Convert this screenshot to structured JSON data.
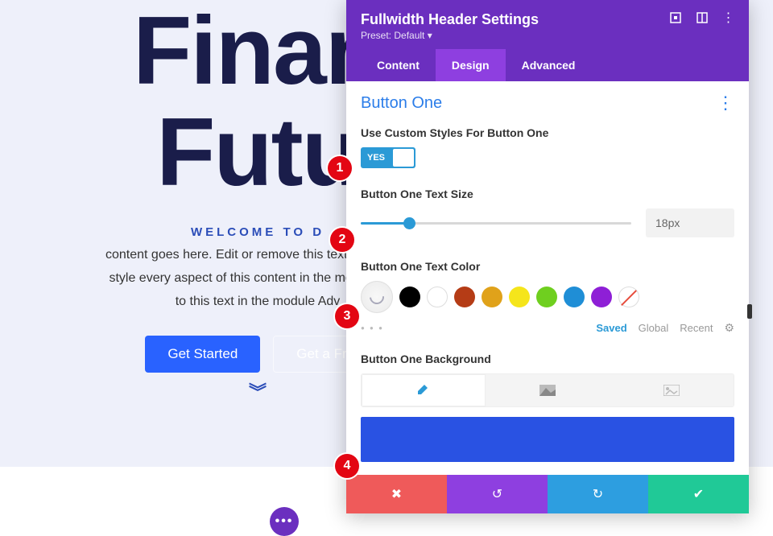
{
  "hero": {
    "title_line1": "Finan",
    "title_line2": "Futu",
    "subtitle": "Welcome to D",
    "body": "content goes here. Edit or remove this text inline or in\nstyle every aspect of this content in the module Desi\nto this text in the module Adv",
    "btn_primary": "Get Started",
    "btn_ghost": "Get a Fr"
  },
  "panel": {
    "title": "Fullwidth Header Settings",
    "preset": "Preset: Default ▾",
    "tabs": [
      "Content",
      "Design",
      "Advanced"
    ],
    "active_tab": 1,
    "section": "Button One",
    "fields": {
      "custom_styles_label": "Use Custom Styles For Button One",
      "toggle_value": "YES",
      "text_size_label": "Button One Text Size",
      "text_size_value": "18px",
      "text_color_label": "Button One Text Color",
      "colors": [
        "transparent",
        "#000000",
        "#ffffff",
        "#b53c16",
        "#e0a21a",
        "#f5e51b",
        "#6fcf1f",
        "#1f8ed6",
        "#8e1fd6",
        "none"
      ],
      "filters": {
        "saved": "Saved",
        "global": "Global",
        "recent": "Recent"
      },
      "bg_label": "Button One Background",
      "bg_preview_color": "#2952e3"
    }
  },
  "markers": [
    "1",
    "2",
    "3",
    "4"
  ]
}
